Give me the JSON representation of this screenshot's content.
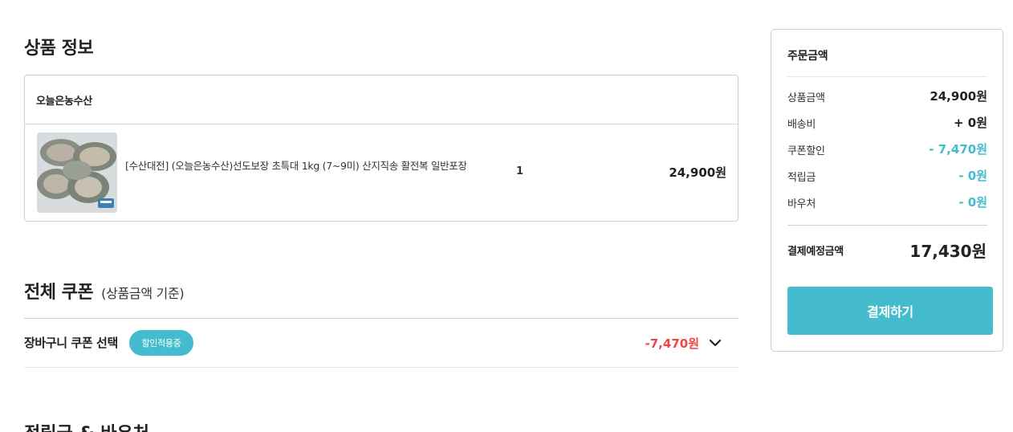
{
  "product_section": {
    "title": "상품 정보",
    "store_name": "오늘은농수산",
    "item": {
      "name": "[수산대전] (오늘은농수산)선도보장 초특대 1kg (7~9미) 산지직송 활전복 일반포장",
      "quantity": "1",
      "price": "24,900원",
      "image": "abalone-photo"
    }
  },
  "coupon_section": {
    "title": "전체 쿠폰",
    "subtitle": "(상품금액 기준)",
    "cart_coupon_label": "장바구니 쿠폰 선택",
    "badge": "할인적용중",
    "amount": "-7,470원",
    "expand_icon": "chevron-down-icon",
    "badge_color": "#45bccd",
    "amount_color": "#f04545"
  },
  "next_section": {
    "title": "적립금 & 바우처"
  },
  "summary": {
    "title": "주문금액",
    "rows": [
      {
        "label": "상품금액",
        "value": "24,900원"
      },
      {
        "label": "배송비",
        "value": "+ 0원"
      },
      {
        "label": "쿠폰할인",
        "value": "- 7,470원"
      },
      {
        "label": "적립금",
        "value": "- 0원"
      },
      {
        "label": "바우처",
        "value": "- 0원"
      }
    ],
    "total_label": "결제예정금액",
    "total_value": "17,430원",
    "pay_button": "결제하기",
    "accent_color": "#45bccd"
  }
}
